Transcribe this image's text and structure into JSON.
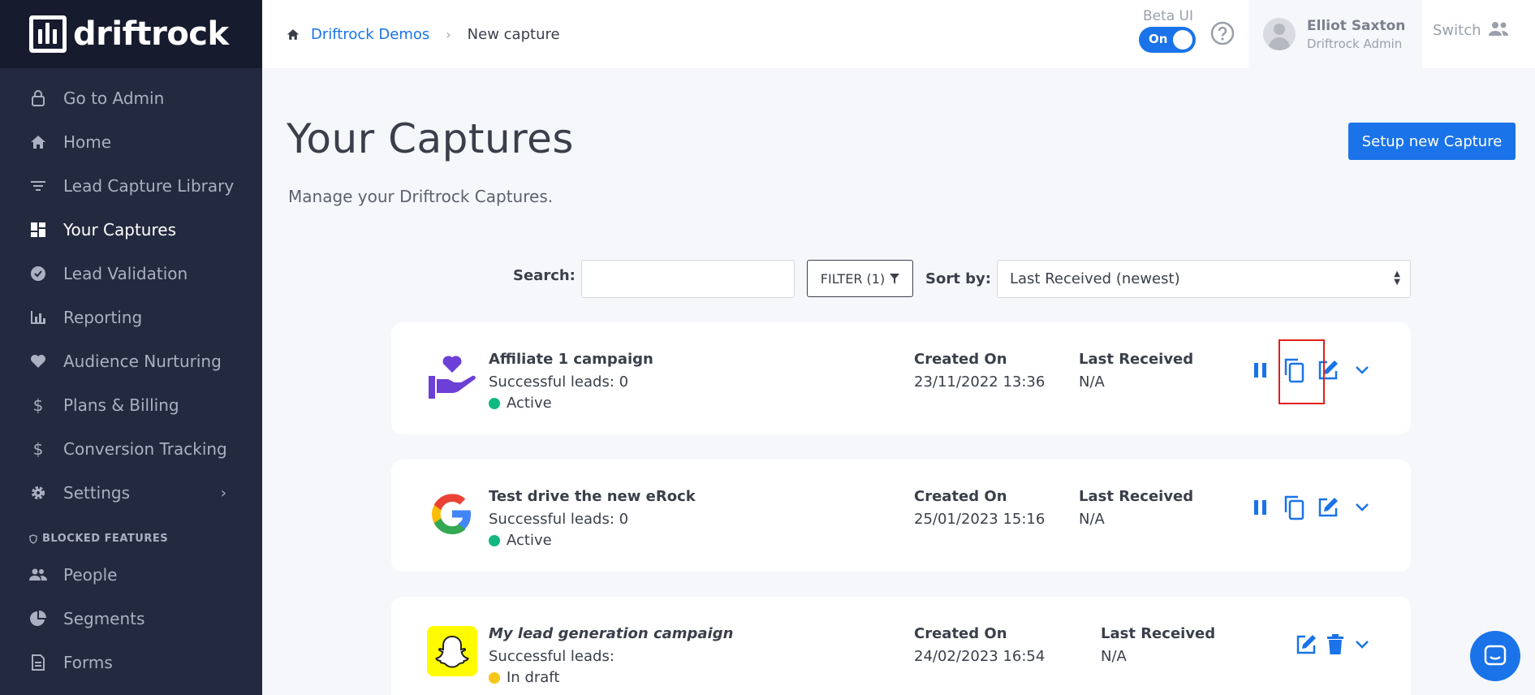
{
  "app": {
    "logo_text": "driftrock"
  },
  "sidebar": {
    "items": [
      {
        "label": "Go to Admin",
        "icon": "lock-icon"
      },
      {
        "label": "Home",
        "icon": "home-icon"
      },
      {
        "label": "Lead Capture Library",
        "icon": "filter-list-icon"
      },
      {
        "label": "Your Captures",
        "icon": "dashboard-icon",
        "active": true
      },
      {
        "label": "Lead Validation",
        "icon": "verified-badge-icon"
      },
      {
        "label": "Reporting",
        "icon": "bar-chart-icon"
      },
      {
        "label": "Audience Nurturing",
        "icon": "heart-icon"
      },
      {
        "label": "Plans & Billing",
        "icon": "dollar-icon"
      },
      {
        "label": "Conversion Tracking",
        "icon": "dollar-icon"
      },
      {
        "label": "Settings",
        "icon": "gear-icon"
      }
    ],
    "blocked_section_label": "BLOCKED FEATURES",
    "blocked_items": [
      {
        "label": "People",
        "icon": "people-icon"
      },
      {
        "label": "Segments",
        "icon": "pie-chart-icon"
      },
      {
        "label": "Forms",
        "icon": "form-icon"
      }
    ]
  },
  "header": {
    "breadcrumb_root": "Driftrock Demos",
    "breadcrumb_current": "New capture",
    "beta_label": "Beta UI",
    "beta_toggle": "On",
    "user_name": "Elliot Saxton",
    "user_role": "Driftrock Admin",
    "switch_label": "Switch"
  },
  "main": {
    "title": "Your Captures",
    "subtitle": "Manage your Driftrock Captures.",
    "setup_button": "Setup new Capture",
    "search_label": "Search:",
    "search_value": "",
    "filter_label": "FILTER (1)",
    "sort_label": "Sort by:",
    "sort_value": "Last Received (newest)",
    "created_label": "Created On",
    "received_label": "Last Received"
  },
  "captures": [
    {
      "name": "Affiliate 1 campaign",
      "leads": "Successful leads: 0",
      "status": "Active",
      "created": "23/11/2022 13:36",
      "last_received": "N/A",
      "logo": "hand-heart-icon"
    },
    {
      "name": "Test drive the new eRock",
      "leads": "Successful leads: 0",
      "status": "Active",
      "created": "25/01/2023 15:16",
      "last_received": "N/A",
      "logo": "google-logo-icon"
    },
    {
      "name": "My lead generation campaign",
      "leads": "Successful leads:",
      "status": "In draft",
      "created": "24/02/2023 16:54",
      "last_received": "N/A",
      "logo": "snapchat-logo-icon"
    }
  ],
  "colors": {
    "accent": "#1a73e8",
    "sidebar_bg": "#232a3f",
    "active_status": "#10b981",
    "draft_status": "#f5c518",
    "highlight": "#e0201a"
  }
}
